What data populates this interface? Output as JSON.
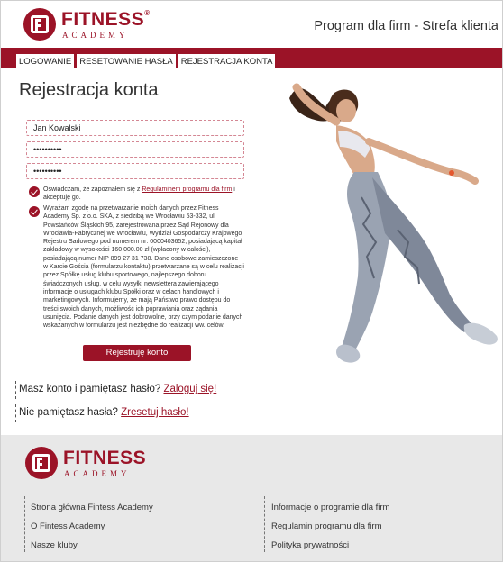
{
  "header": {
    "brand_name": "FITNESS",
    "brand_registered": "®",
    "brand_sub": "ACADEMY",
    "page_title": "Program dla firm - Strefa klienta"
  },
  "tabs": [
    {
      "label": "LOGOWANIE",
      "active": false
    },
    {
      "label": "RESETOWANIE HASŁA",
      "active": false
    },
    {
      "label": "REJESTRACJA KONTA",
      "active": true
    }
  ],
  "form": {
    "title": "Rejestracja konta",
    "name_value": "Jan Kowalski",
    "password_value": "••••••••••",
    "password_repeat_value": "••••••••••",
    "consent1_before": "Oświadczam, że zapoznałem się z ",
    "consent1_link": "Regulaminem programu dla firm",
    "consent1_after": " i akceptuję go.",
    "consent1_checked": true,
    "consent2_text": "Wyrażam zgodę na przetwarzanie moich danych przez Fitness Academy Sp. z o.o. SKA, z siedzibą we Wrocławiu 53-332, ul Powstańców Śląskich 95, zarejestrowana przez Sąd Rejonowy dla Wrocławia-Fabrycznej we Wrocławiu, Wydział Gospodarczy Krajowego Rejestru Sadowego pod numerem nr: 0000403652, posiadającą kapitał zakładowy w wysokości 160 000.00 zł (wpłacony w całości), posiadającą numer NIP 899 27 31 738. Dane osobowe zamieszczone w Karcie Gościa (formularzu kontaktu) przetwarzane są w celu realizacji przez Spółkę usług klubu sportowego, najlepszego doboru świadczonych usług, w celu wysyłki newslettera zawierającego informacje o usługach klubu Spółki oraz w celach handlowych i marketingowych. Informujemy, ze mają Państwo prawo dostępu do treści swoich danych, możliwość ich poprawiania oraz żądania usunięcia. Podanie danych jest dobrowolne, przy czym podanie danych wskazanych w formularzu jest niezbędne do realizacji ww. celów.",
    "consent2_checked": true,
    "submit_label": "Rejestruję konto"
  },
  "links": {
    "login_prompt": "Masz konto i pamiętasz hasło? ",
    "login_link": "Zaloguj się!",
    "reset_prompt": "Nie pamiętasz hasła? ",
    "reset_link": "Zresetuj hasło!"
  },
  "footer": {
    "brand_name": "FITNESS",
    "brand_sub": "ACADEMY",
    "col1": [
      "Strona główna Fintess Academy",
      "O Fintess Academy",
      "Nasze kluby"
    ],
    "col2": [
      "Informacje o programie dla firm",
      "Regulamin programu dla firm",
      "Polityka prywatności"
    ]
  },
  "colors": {
    "brand": "#9b1327",
    "footer_bg": "#e8e8e8"
  }
}
